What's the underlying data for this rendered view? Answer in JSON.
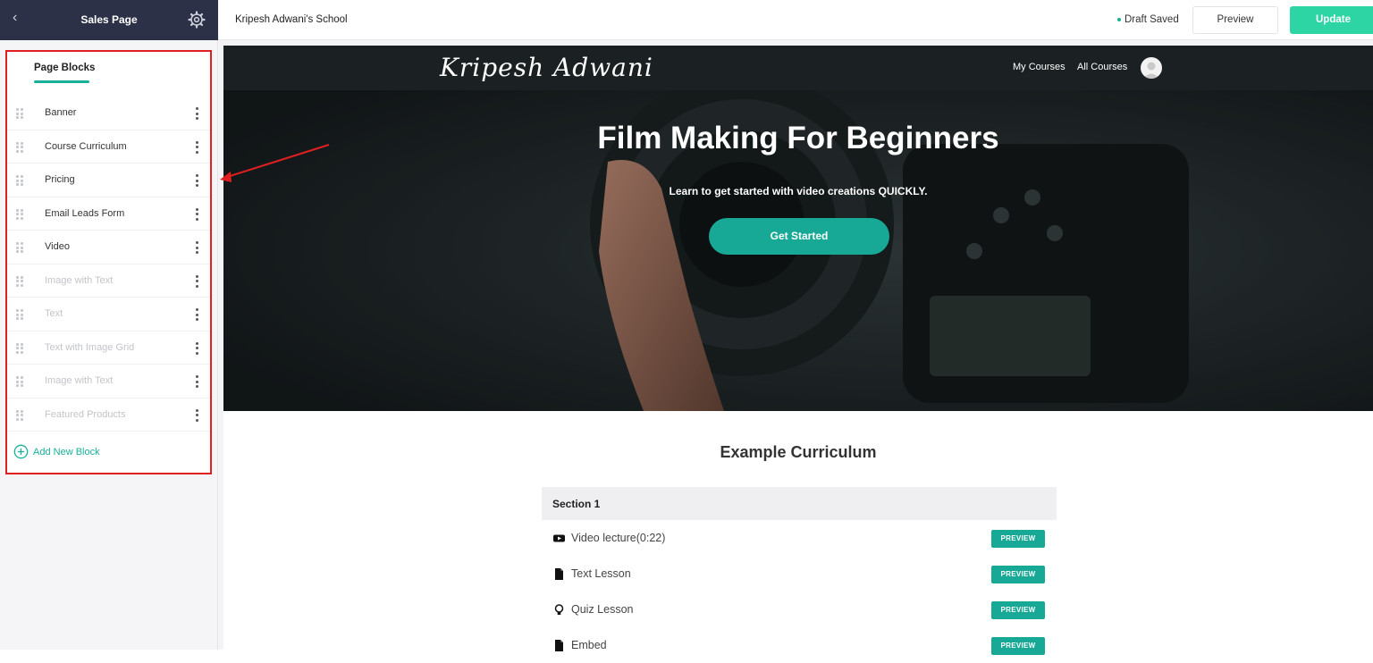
{
  "sidebar": {
    "title": "Sales Page",
    "tab_label": "Page Blocks",
    "blocks": [
      {
        "label": "Banner"
      },
      {
        "label": "Course Curriculum"
      },
      {
        "label": "Pricing"
      },
      {
        "label": "Email Leads Form"
      },
      {
        "label": "Video"
      },
      {
        "label": "Image with Text"
      },
      {
        "label": "Text"
      },
      {
        "label": "Text with Image Grid"
      },
      {
        "label": "Image with Text"
      },
      {
        "label": "Featured Products"
      }
    ],
    "add_block_label": "Add New Block"
  },
  "topbar": {
    "school_name": "Kripesh Adwani's School",
    "status": "Draft Saved",
    "preview_label": "Preview",
    "update_label": "Update"
  },
  "hero": {
    "logo_text": "Kripesh Adwani",
    "nav_links": [
      "My Courses",
      "All Courses"
    ],
    "title": "Film Making For Beginners",
    "subtitle": "Learn to get started with video creations QUICKLY.",
    "cta_label": "Get Started"
  },
  "curriculum": {
    "title": "Example Curriculum",
    "section": "Section 1",
    "lessons": [
      {
        "label": "Video lecture(0:22)",
        "icon": "video-icon",
        "badge": "PREVIEW"
      },
      {
        "label": "Text Lesson",
        "icon": "document-icon",
        "badge": "PREVIEW"
      },
      {
        "label": "Quiz Lesson",
        "icon": "lightbulb-icon",
        "badge": "PREVIEW"
      },
      {
        "label": "Embed",
        "icon": "document-icon",
        "badge": "PREVIEW"
      }
    ]
  },
  "colors": {
    "accent": "#17a996",
    "update_button": "#2dd4a4",
    "sidebar_header": "#2c3148",
    "highlight_border": "#e02020"
  }
}
